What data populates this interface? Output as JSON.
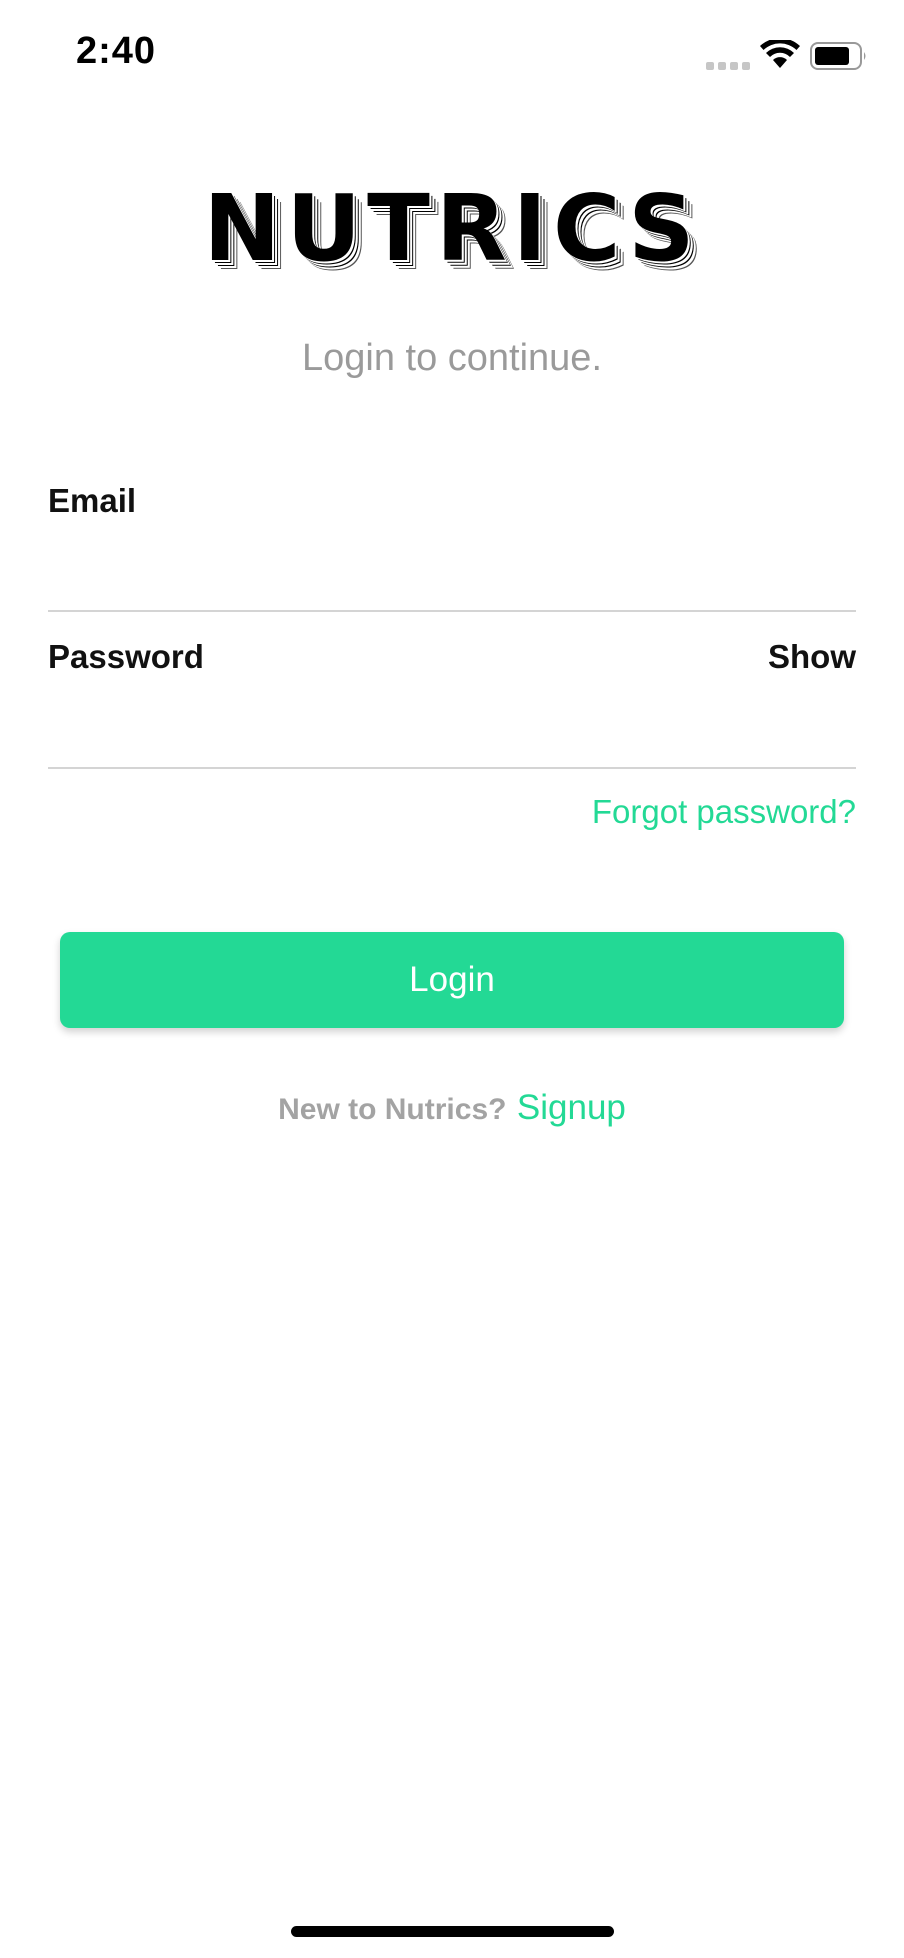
{
  "status_bar": {
    "time": "2:40",
    "icons": [
      "signal-icon",
      "wifi-icon",
      "battery-icon"
    ]
  },
  "app": {
    "logo_text": "NUTRICS",
    "subtitle": "Login to continue."
  },
  "form": {
    "email_label": "Email",
    "email_value": "",
    "email_placeholder": "",
    "password_label": "Password",
    "password_value": "",
    "password_placeholder": "",
    "show_toggle": "Show",
    "forgot_password": "Forgot password?"
  },
  "actions": {
    "login_label": "Login",
    "signup_prompt": "New to Nutrics?",
    "signup_link": "Signup"
  },
  "colors": {
    "accent": "#23d995",
    "muted_text": "#9a9a9a",
    "divider": "#d4d4d4"
  }
}
